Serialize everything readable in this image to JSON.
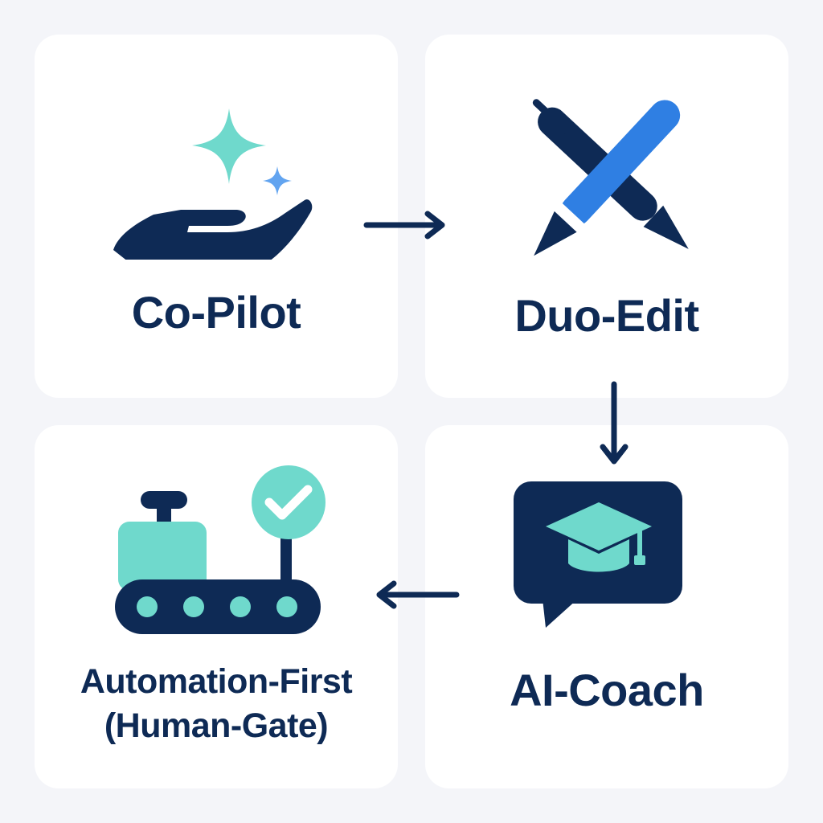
{
  "colors": {
    "navy": "#0e2a55",
    "teal": "#6fd9cc",
    "blue": "#2f7fe3",
    "light_blue": "#62a4f0",
    "background": "#f4f5f9",
    "card": "#ffffff"
  },
  "cards": [
    {
      "label": "Co-Pilot",
      "icon": "hand-with-sparkles-icon"
    },
    {
      "label": "Duo-Edit",
      "icon": "crossed-pencils-icon"
    },
    {
      "label": "AI-Coach",
      "icon": "chat-graduation-cap-icon"
    },
    {
      "label_line1": "Automation-First",
      "label_line2": "(Human-Gate)",
      "icon": "conveyor-checkmark-icon"
    }
  ],
  "flow": [
    {
      "from": "Co-Pilot",
      "to": "Duo-Edit",
      "direction": "right"
    },
    {
      "from": "Duo-Edit",
      "to": "AI-Coach",
      "direction": "down"
    },
    {
      "from": "AI-Coach",
      "to": "Automation-First (Human-Gate)",
      "direction": "left"
    }
  ]
}
